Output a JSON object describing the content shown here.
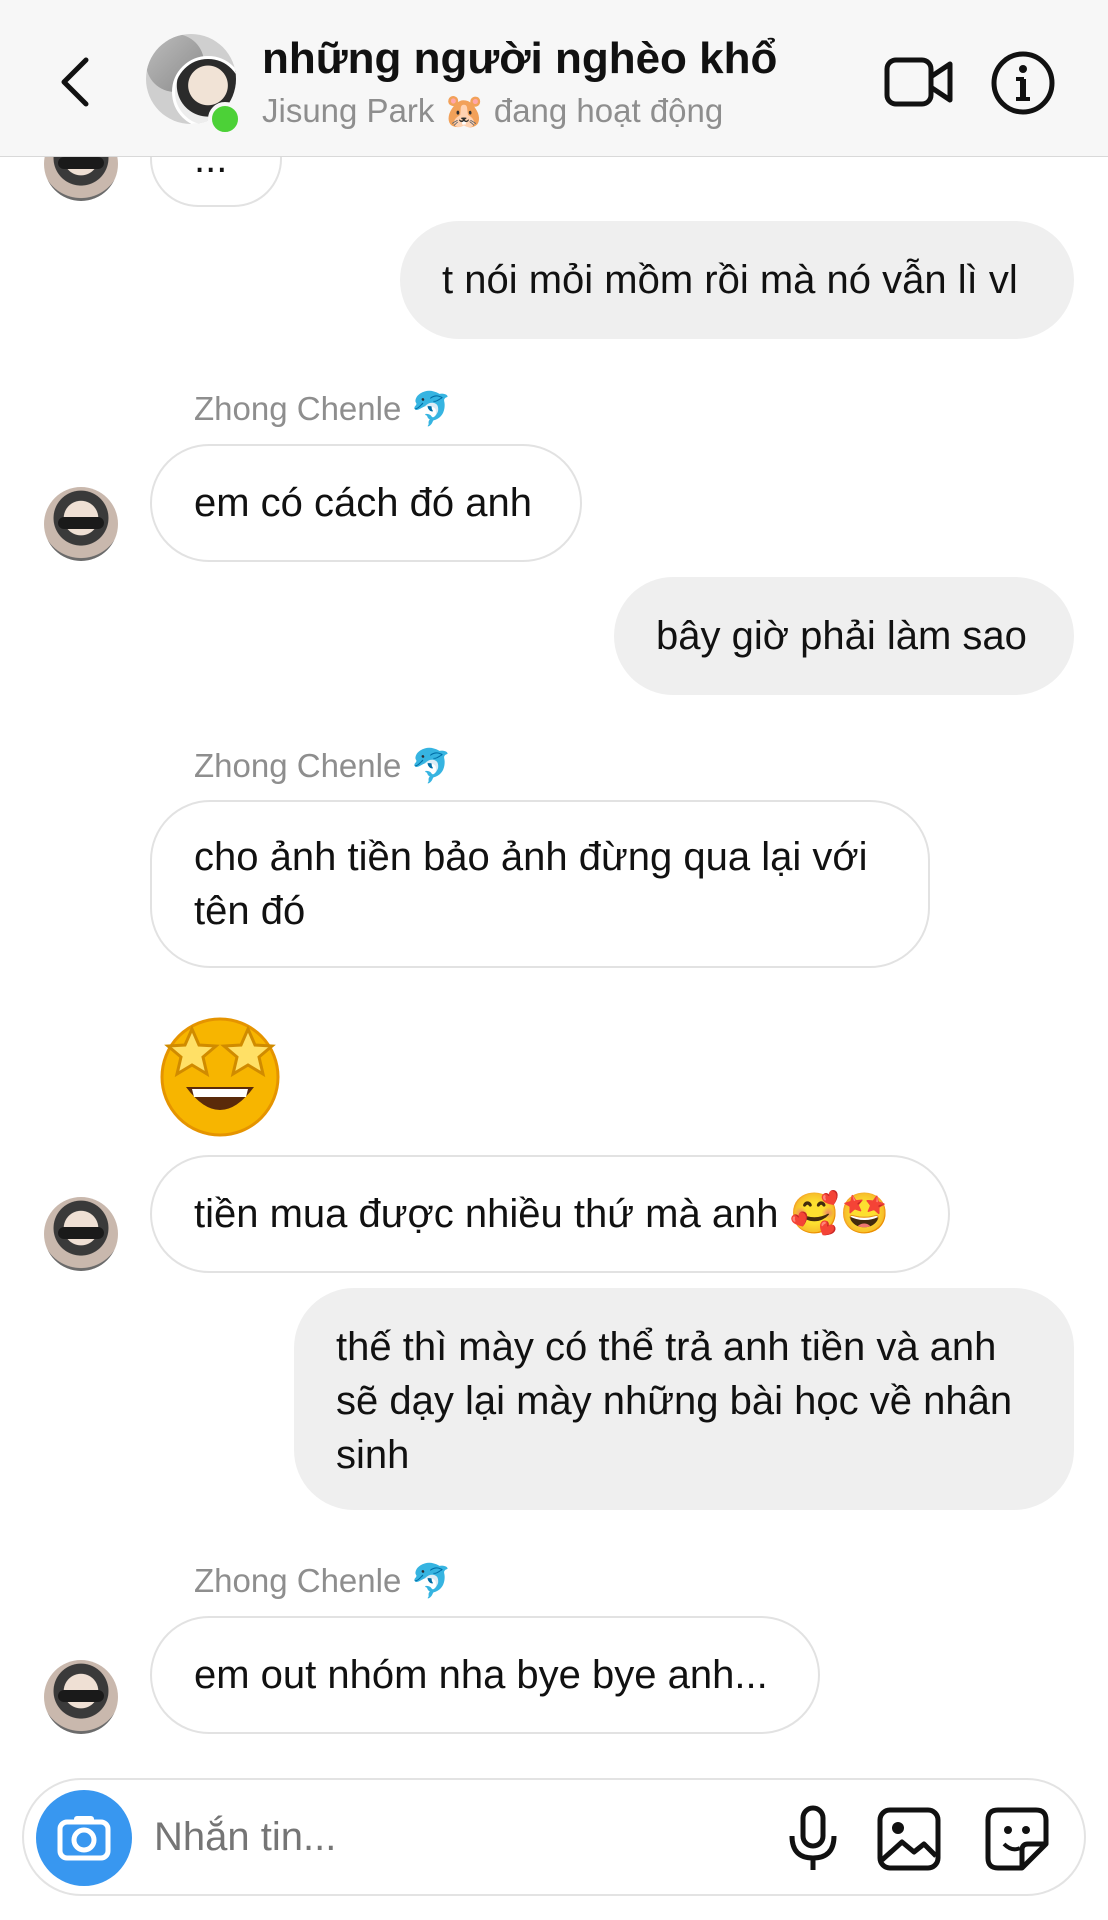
{
  "header": {
    "title": "những người nghèo khổ",
    "subtitle": "Jisung Park 🐹 đang hoạt động"
  },
  "messages": [
    {
      "side": "in",
      "text": "..."
    },
    {
      "side": "out",
      "text": "t nói mỏi mồm rồi mà nó vẫn lì vl"
    },
    {
      "side": "in",
      "sender": "Zhong Chenle 🐬",
      "text": "em có cách đó anh"
    },
    {
      "side": "out",
      "text": "bây giờ phải làm sao"
    },
    {
      "side": "in",
      "sender": "Zhong Chenle 🐬",
      "text_lines": [
        "cho ảnh tiền bảo ảnh đừng qua lại với",
        "tên đó"
      ]
    },
    {
      "side": "in",
      "emoji": "🤩",
      "emoji_name": "star-struck"
    },
    {
      "side": "in",
      "text": "tiền mua được nhiều thứ mà anh 🥰🤩"
    },
    {
      "side": "out",
      "text_lines": [
        "thế thì mày có thể trả anh tiền và anh",
        "sẽ dạy lại mày những bài học về nhân",
        "sinh"
      ]
    },
    {
      "side": "in",
      "sender": "Zhong Chenle 🐬",
      "text": "em out nhóm nha bye bye anh..."
    }
  ],
  "composer": {
    "placeholder": "Nhắn tin..."
  },
  "icons": {
    "back": "chevron-left-icon",
    "video": "video-camera-icon",
    "info": "info-icon",
    "camera": "camera-icon",
    "mic": "microphone-icon",
    "gallery": "image-icon",
    "sticker": "sticker-icon"
  },
  "colors": {
    "accent": "#3897f0",
    "online": "#4cd137",
    "bubble_out": "#efefef",
    "bubble_in_border": "#e2e2e2",
    "muted_text": "#8e8e8e"
  }
}
